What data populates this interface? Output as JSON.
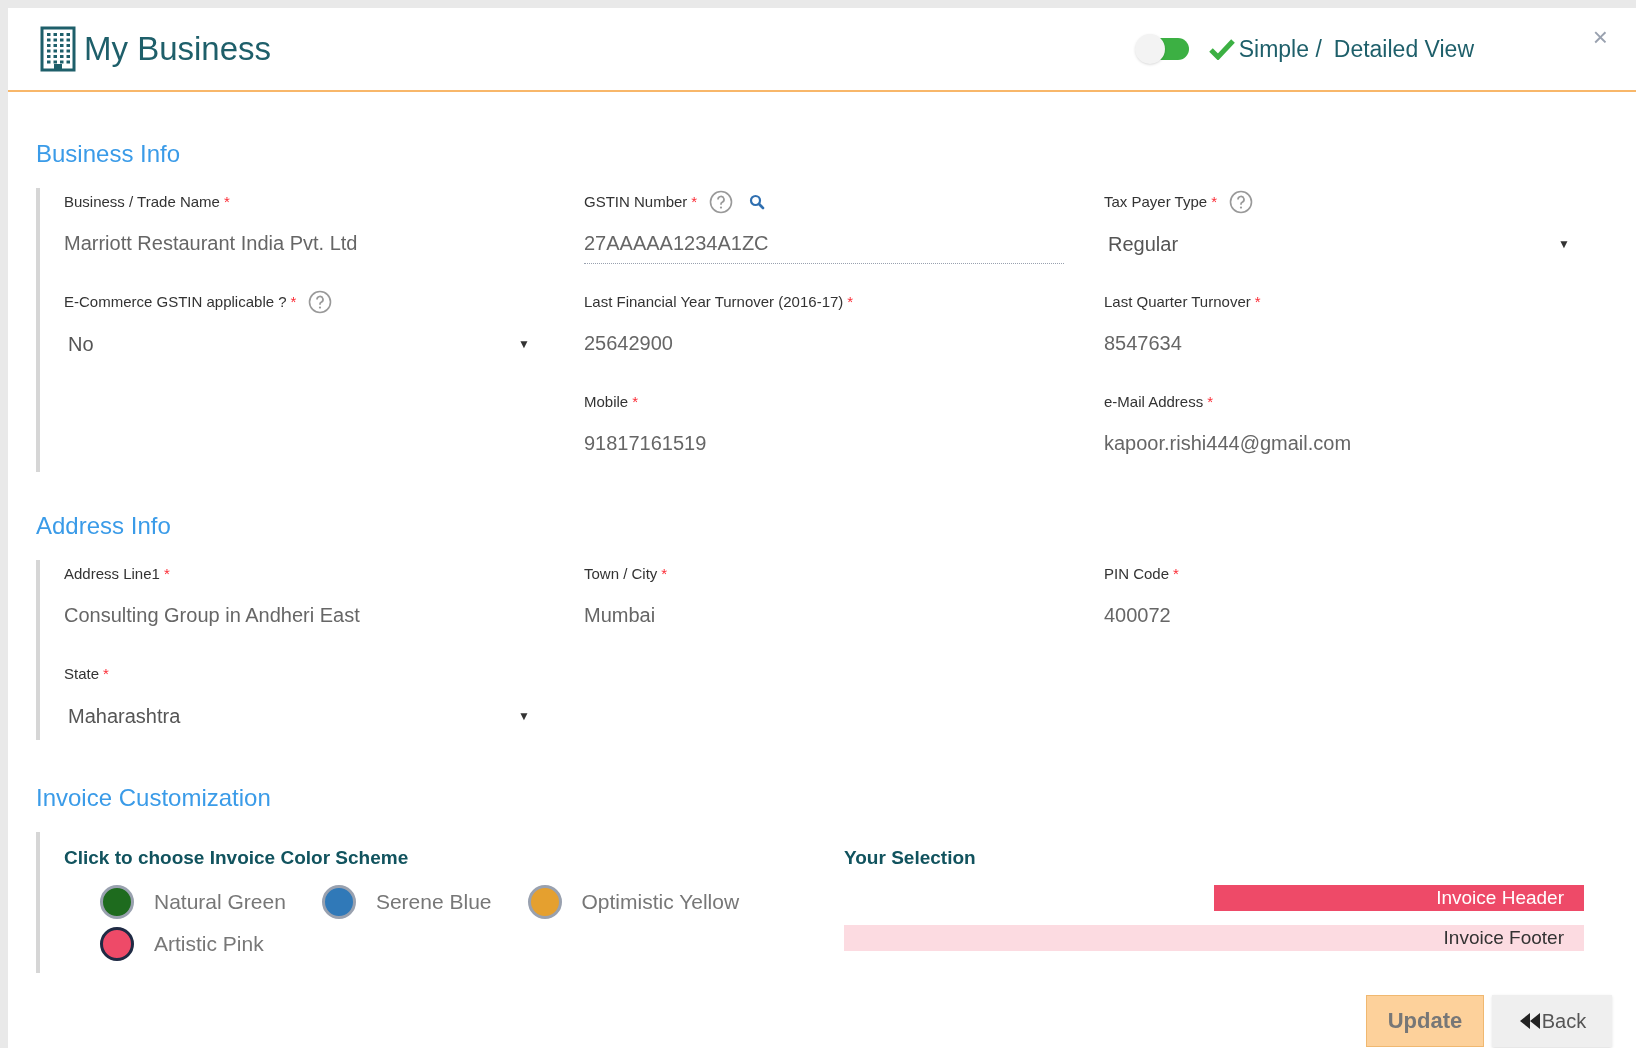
{
  "header": {
    "title": "My Business",
    "toggle_on": false,
    "view_simple": "Simple /",
    "view_detailed": "Detailed View",
    "close": "×"
  },
  "sections": [
    {
      "title": "Business Info",
      "rows": [
        [
          {
            "kind": "text",
            "label": "Business / Trade Name",
            "required_mark": "*",
            "value": "Marriott Restaurant India Pvt. Ltd"
          },
          {
            "kind": "lookup",
            "label": "GSTIN Number",
            "required_mark": "*",
            "icons": [
              {
                "kind": "help"
              },
              {
                "kind": "search"
              }
            ],
            "value": "27AAAAA1234A1ZC"
          },
          {
            "kind": "select",
            "label": "Tax Payer Type",
            "required_mark": "*",
            "icons": [
              {
                "kind": "help"
              }
            ],
            "value": "Regular",
            "caret": "▼"
          }
        ],
        [
          {
            "kind": "select",
            "label": "E-Commerce GSTIN applicable ?",
            "required_mark": "*",
            "icons": [
              {
                "kind": "help"
              }
            ],
            "value": "No",
            "caret": "▼"
          },
          {
            "kind": "text",
            "label": "Last Financial Year Turnover (2016-17)",
            "required_mark": "*",
            "value": "25642900"
          },
          {
            "kind": "text",
            "label": "Last Quarter Turnover",
            "required_mark": "*",
            "value": "8547634"
          }
        ],
        [
          {
            "kind": "empty"
          },
          {
            "kind": "text",
            "label": "Mobile",
            "required_mark": "*",
            "value": "91817161519"
          },
          {
            "kind": "text",
            "label": "e-Mail Address",
            "required_mark": "*",
            "value": "kapoor.rishi444@gmail.com"
          }
        ]
      ]
    },
    {
      "title": "Address Info",
      "rows": [
        [
          {
            "kind": "text",
            "label": "Address Line1",
            "required_mark": "*",
            "value": "Consulting Group in Andheri East"
          },
          {
            "kind": "text",
            "label": "Town / City",
            "required_mark": "*",
            "value": "Mumbai"
          },
          {
            "kind": "text",
            "label": "PIN Code",
            "required_mark": "*",
            "value": "400072"
          }
        ],
        [
          {
            "kind": "select",
            "label": "State",
            "required_mark": "*",
            "value": "Maharashtra",
            "caret": "▼"
          }
        ]
      ]
    }
  ],
  "invoice": {
    "title": "Invoice Customization",
    "prompt": "Click to choose Invoice Color Scheme",
    "schemes": [
      {
        "label": "Natural Green",
        "color": "#1e6b1e",
        "selected": false
      },
      {
        "label": "Serene Blue",
        "color": "#3079b8",
        "selected": false
      },
      {
        "label": "Optimistic Yellow",
        "color": "#e5a02f",
        "selected": false
      },
      {
        "label": "Artistic Pink",
        "color": "#ee4a68",
        "selected": true
      }
    ],
    "selection_title": "Your Selection",
    "header_label": "Invoice Header",
    "footer_label": "Invoice Footer"
  },
  "buttons": {
    "update": "Update",
    "back": "Back"
  }
}
